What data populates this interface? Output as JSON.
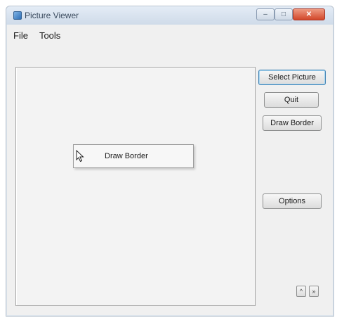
{
  "window": {
    "title": "Picture Viewer",
    "controls": {
      "minimize": "–",
      "maximize": "□",
      "close": "✕"
    }
  },
  "menu": {
    "items": [
      "File",
      "Tools"
    ]
  },
  "buttons": {
    "select_picture": "Select Picture",
    "quit": "Quit",
    "draw_border": "Draw Border",
    "options": "Options",
    "scroll_up": "^",
    "scroll_down": "»"
  },
  "context_menu": {
    "items": [
      "Draw Border"
    ]
  },
  "colors": {
    "titlebar": "#d6e1ee",
    "close_button": "#d2472a",
    "focus_border": "#3c7fb1"
  }
}
